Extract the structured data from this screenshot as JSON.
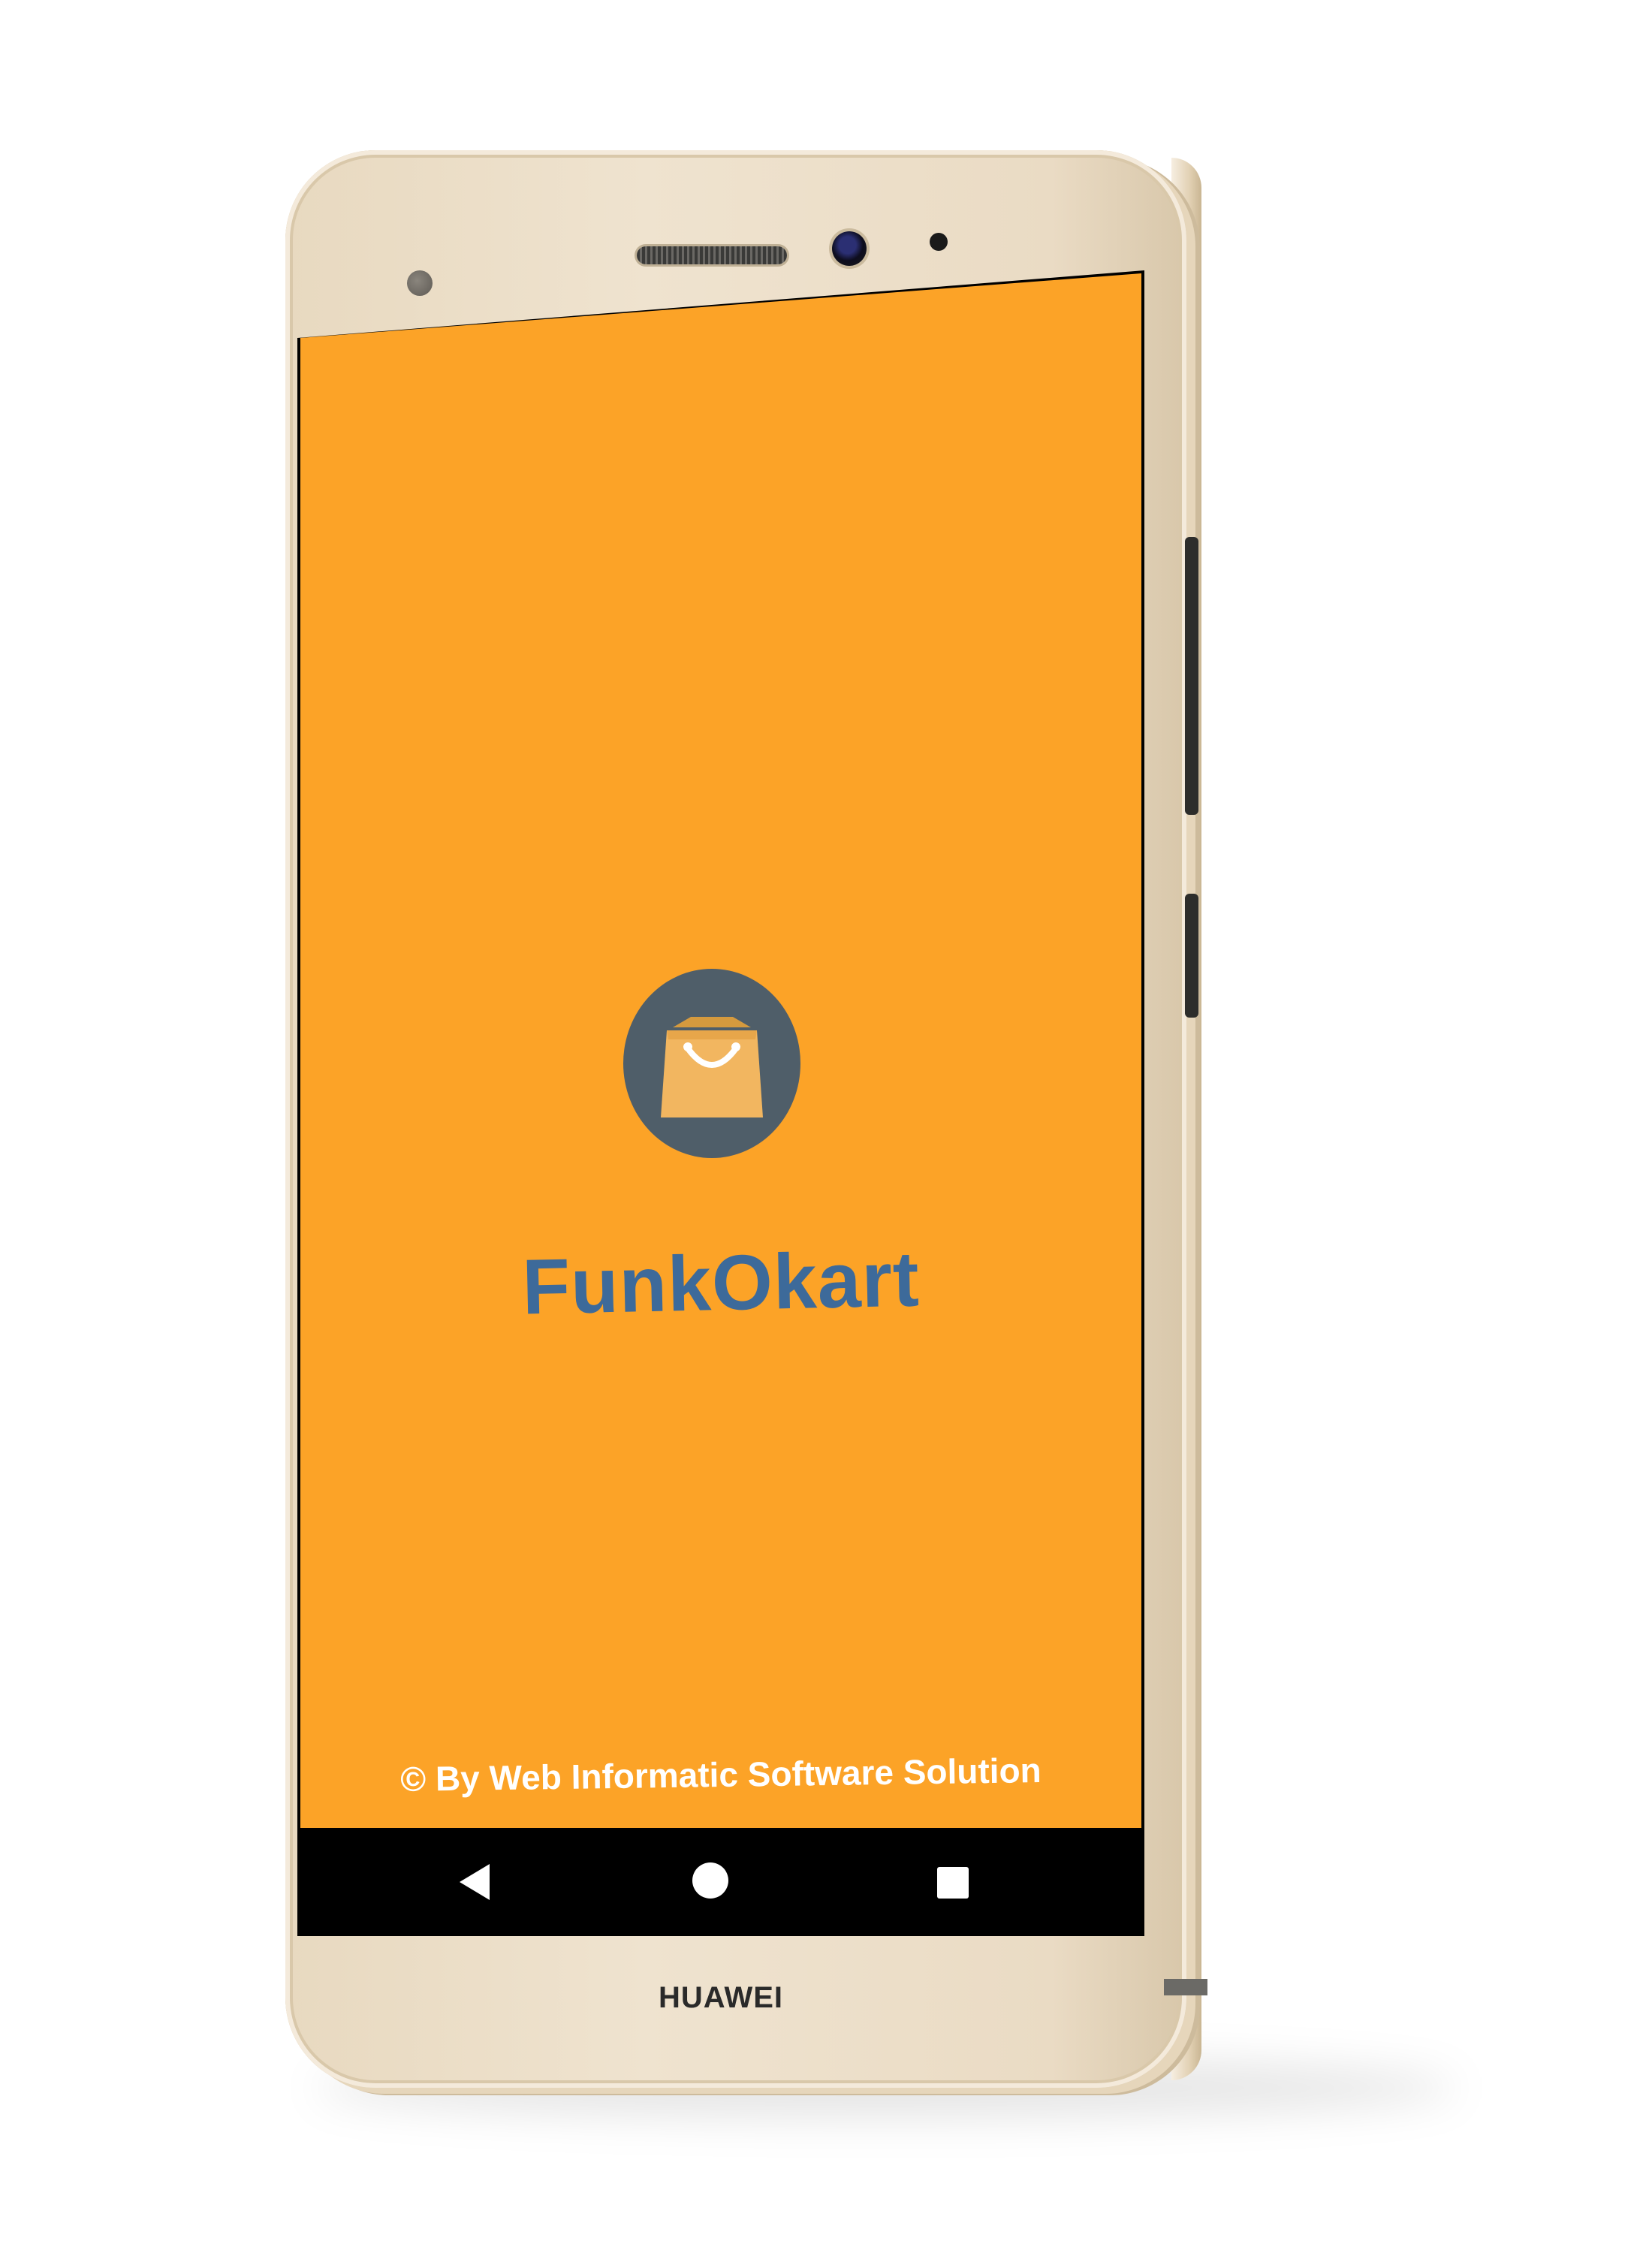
{
  "device": {
    "brand": "HUAWEI"
  },
  "app": {
    "title": "FunkOkart",
    "copyright": "© By Web Informatic Software Solution",
    "logo_icon": "shopping-bag-icon",
    "background_color": "#fca327",
    "title_color": "#3d6a9a",
    "logo_circle_color": "#4f5e69"
  },
  "nav_bar": {
    "back_icon": "back-triangle-icon",
    "home_icon": "home-circle-icon",
    "recents_icon": "recents-square-icon"
  }
}
